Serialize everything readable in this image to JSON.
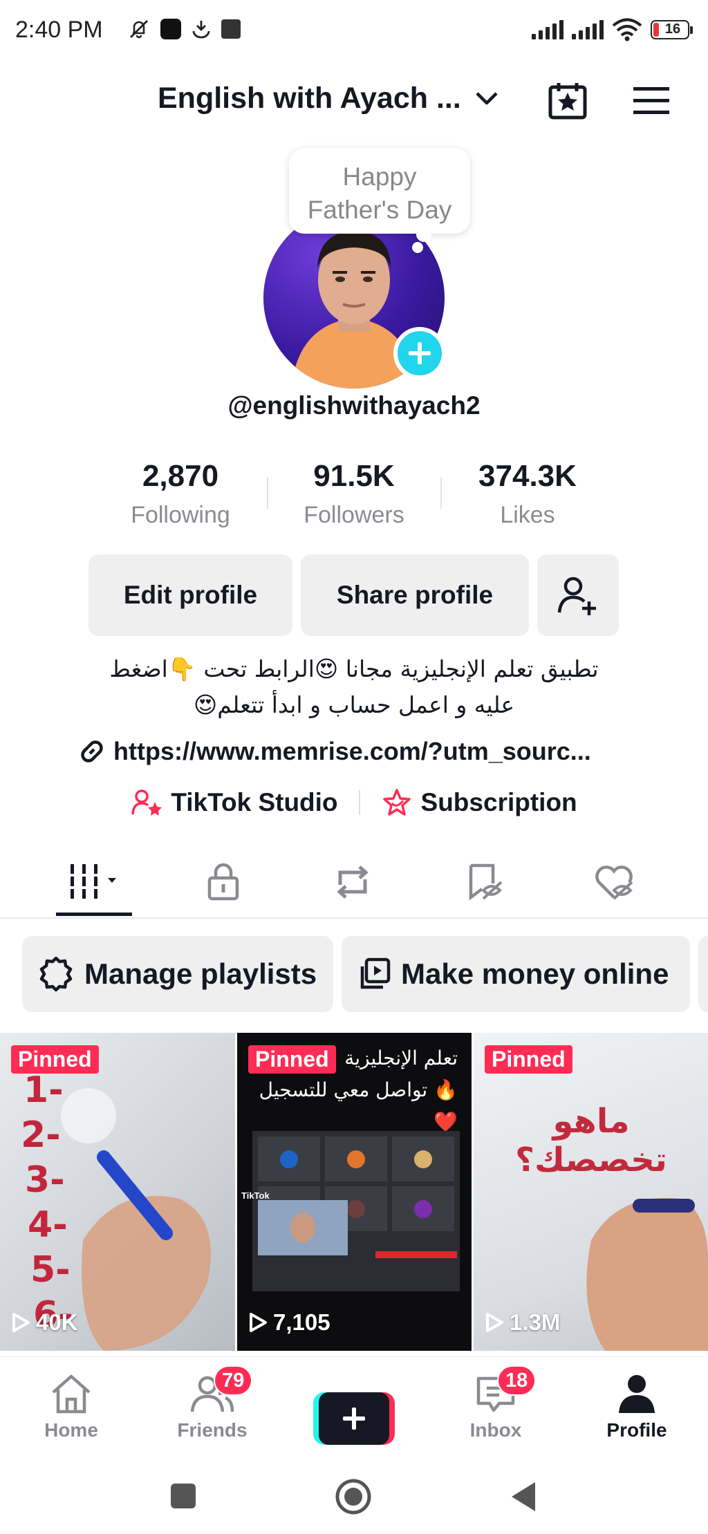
{
  "status_bar": {
    "time": "2:40 PM",
    "battery": "16"
  },
  "header": {
    "account_name": "English with Ayach ..."
  },
  "avatar": {
    "bubble_text": "Happy Father's Day"
  },
  "handle": "@englishwithayach2",
  "stats": [
    {
      "value": "2,870",
      "label": "Following"
    },
    {
      "value": "91.5K",
      "label": "Followers"
    },
    {
      "value": "374.3K",
      "label": "Likes"
    }
  ],
  "buttons": {
    "edit": "Edit profile",
    "share": "Share profile"
  },
  "bio": {
    "line1": "تطبيق تعلم الإنجليزية مجانا 😍الرابط تحت 👇اضغط",
    "line2": "عليه و اعمل حساب و ابدأ تتعلم😍"
  },
  "link": "https://www.memrise.com/?utm_sourc...",
  "tools": {
    "studio": "TikTok Studio",
    "subscription": "Subscription"
  },
  "chips": {
    "playlists": "Manage playlists",
    "money": "Make money online"
  },
  "videos": [
    {
      "pinned": "Pinned",
      "views": "40K"
    },
    {
      "pinned": "Pinned",
      "views": "7,105",
      "caption1": "تعلم الإنجليزية",
      "caption2": "🔥 تواصل معي للتسجيل ❤️",
      "watermark": "TikTok"
    },
    {
      "pinned": "Pinned",
      "views": "1.3M",
      "board_text": "ماهو تخصصك؟"
    }
  ],
  "nav": {
    "home": "Home",
    "friends": "Friends",
    "friends_badge": "79",
    "inbox": "Inbox",
    "inbox_badge": "18",
    "profile": "Profile"
  },
  "colors": {
    "accent": "#fe2c55",
    "cyan": "#25f4ee",
    "text": "#161823",
    "muted": "#8a8b91"
  }
}
